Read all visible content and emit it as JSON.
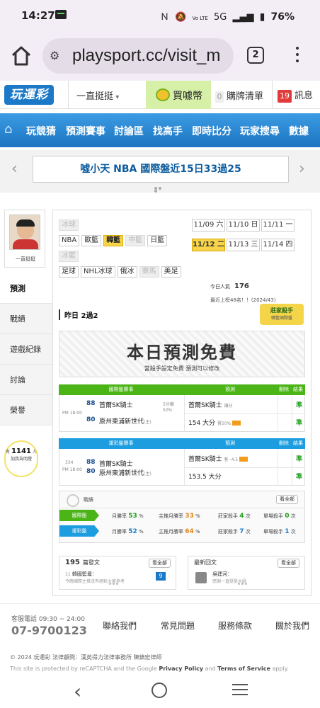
{
  "status": {
    "time": "14:27",
    "signal": "5G",
    "volte": "Vo LTE",
    "battery": "76%"
  },
  "browser": {
    "url": "playsport.cc/visit_m",
    "tab_count": "2"
  },
  "header": {
    "logo": "玩運彩",
    "user": "一直挺挺",
    "buy_coins": "買噱幣",
    "cart_count": "0",
    "cart_label": "購牌清單",
    "msg_count": "19",
    "msg_label": "訊息"
  },
  "nav": [
    "玩競猜",
    "預測賽事",
    "討論區",
    "找高手",
    "即時比分",
    "玩家搜尋",
    "數據"
  ],
  "announcement": "噓小天 NBA 國際盤近15日33過25",
  "profile": {
    "name": "一直挺挺"
  },
  "side_menu": [
    "預測",
    "戰績",
    "遊戲紀錄",
    "討論",
    "榮譽"
  ],
  "fans": {
    "prefix": "有",
    "count": "1141",
    "suffix": "人",
    "label": "加我為明燈"
  },
  "sports": {
    "row1": [
      "冰球"
    ],
    "row2": [
      "NBA",
      "歐籃",
      "韓籃",
      "中籃",
      "日籃"
    ],
    "row3": [
      "冰籃"
    ],
    "row4": [
      "足球",
      "NHL冰球",
      "俄冰",
      "賽馬",
      "美足"
    ]
  },
  "dates": [
    "11/09 六",
    "11/10 日",
    "11/11 一",
    "11/12 二",
    "11/13 三",
    "11/14 四"
  ],
  "views": {
    "label": "今日人氣",
    "value": "176"
  },
  "rank_text": "最近上榜48名！！(2024/43)",
  "badge": {
    "title": "莊家殺手",
    "sub": "韓籃國際盤"
  },
  "yesterday": "昨日 2過2",
  "free": {
    "title": "本日預測免費",
    "sub": "當殺手設定免費 預測可以修改"
  },
  "intl_table": {
    "headers": [
      "國際盤賽事",
      "預測",
      "刪除",
      "結果"
    ],
    "time": "PM 18:00",
    "team1_num": "88",
    "team1": "首爾SK騎士",
    "handicap": "5分輸",
    "pct": "50%",
    "team2_num": "80",
    "team2": "原州東浦新世代",
    "team2_tag": "(主)",
    "pick1": "首爾SK騎士",
    "pick1_note": "讓分",
    "pick2": "154 大分",
    "pick2_pct": "賣50%",
    "result1": "準",
    "result2": "準"
  },
  "tw_table": {
    "headers": [
      "運彩盤賽事",
      "預測",
      "刪除",
      "結果"
    ],
    "game_no": "334",
    "time": "PM 18:00",
    "team1_num": "88",
    "team1": "首爾SK騎士",
    "team2_num": "80",
    "team2": "原州東浦新世代",
    "team2_tag": "(主)",
    "pick1": "首爾SK騎士",
    "pick1_note": "客 -4.5",
    "pick2": "153.5 大分",
    "result1": "準",
    "result2": "準"
  },
  "stats": {
    "title": "戰績",
    "see_all": "看全部",
    "rows": [
      {
        "tag": "國際盤",
        "win_label": "月勝率",
        "win": "53",
        "main_label": "主推月勝率",
        "main": "33",
        "killer_label": "莊家殺手",
        "killer": "4",
        "killer_unit": "次",
        "single_label": "單場殺手",
        "single": "0",
        "single_unit": "次"
      },
      {
        "tag": "運彩盤",
        "win_label": "月勝率",
        "win": "52",
        "main_label": "主推月勝率",
        "main": "64",
        "killer_label": "莊家殺手",
        "killer": "7",
        "killer_unit": "次",
        "single_label": "單場殺手",
        "single": "1",
        "single_unit": "次"
      }
    ]
  },
  "posts": {
    "count": "195",
    "label": "篇發文",
    "see_all": "看全部",
    "item_no": "11",
    "item_title": "韓國籃壇：",
    "item_sub": "今晚國際主推沒有絕對大家參考",
    "item_count": "9"
  },
  "replies": {
    "label": "最新回文",
    "see_all": "看全部",
    "item_title": "吳建河：",
    "item_sub": "感謝一直挺挺大師"
  },
  "footer": {
    "service": "客服電話 09:30 ~ 24:00",
    "phone": "07-9700123",
    "links": [
      "聯絡我們",
      "常見問題",
      "服務條款",
      "關於我們"
    ],
    "copyright": "© 2024 玩運彩 法律顧問：漢英得力法律事務所 陳鎮宏律師",
    "recaptcha_pre": "This site is protected by reCAPTCHA and the Google ",
    "privacy": "Privacy Policy",
    "and": " and ",
    "terms": "Terms of Service",
    "apply": " apply."
  }
}
